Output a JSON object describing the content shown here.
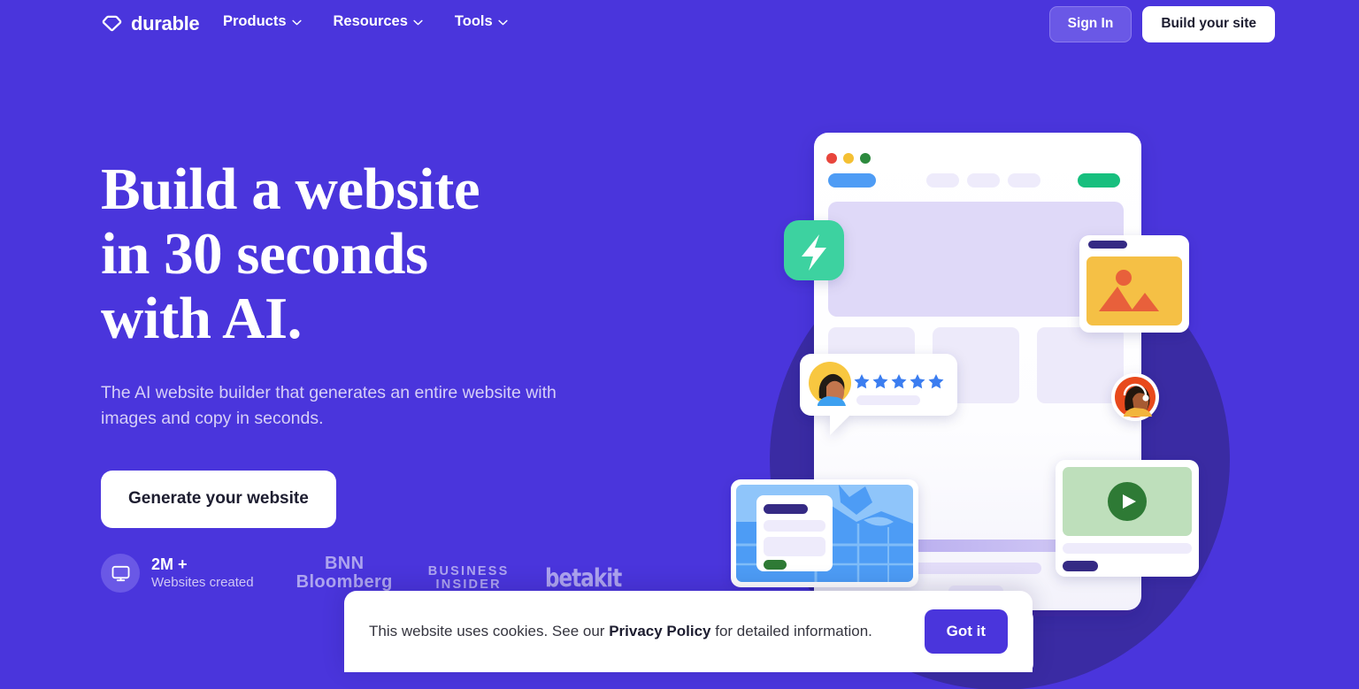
{
  "brand": {
    "name": "durable",
    "logo_icon": "diamond-gem-icon",
    "accent": "#4A35DC",
    "background": "#4A35DC"
  },
  "nav": {
    "links": [
      {
        "label": "Products",
        "icon": "chevron-down-icon"
      },
      {
        "label": "Resources",
        "icon": "chevron-down-icon"
      },
      {
        "label": "Tools",
        "icon": "chevron-down-icon"
      }
    ],
    "sign_in_label": "Sign In",
    "build_site_label": "Build your site"
  },
  "hero": {
    "title_line1": "Build a website",
    "title_line2": "in 30 seconds",
    "title_line3": "with AI.",
    "subtitle": "The AI website builder that generates an entire website with images and copy in seconds.",
    "cta_label": "Generate your website"
  },
  "proof": {
    "stat_icon": "monitor-icon",
    "stat_number": "2M +",
    "stat_label": "Websites created",
    "press": [
      {
        "name": "bnn-bloomberg-logo",
        "line1": "BNN",
        "line2": "Bloomberg"
      },
      {
        "name": "business-insider-logo",
        "line1": "BUSINESS",
        "line2": "INSIDER"
      },
      {
        "name": "betakit-logo",
        "line1": "betakit",
        "line2": ""
      }
    ]
  },
  "illustration": {
    "name": "hero-website-builder-illustration",
    "browser_dots": [
      "#E8453C",
      "#F4C033",
      "#2D8A3E"
    ],
    "lightning_badge_color": "#3ED2A0",
    "image_card_color": "#F5C044",
    "video_card_color": "#BEDFBB",
    "map_card_color": "#4E9CF5",
    "review_stars": 5,
    "review_star_color": "#3B7DF0",
    "avatar_badge_color": "#E8481E",
    "backdrop_circle_color": "#3A2BA3"
  },
  "cookie_banner": {
    "text_before": "This website uses cookies. See our ",
    "link_label": "Privacy Policy",
    "text_after": " for detailed information.",
    "accept_label": "Got it"
  }
}
